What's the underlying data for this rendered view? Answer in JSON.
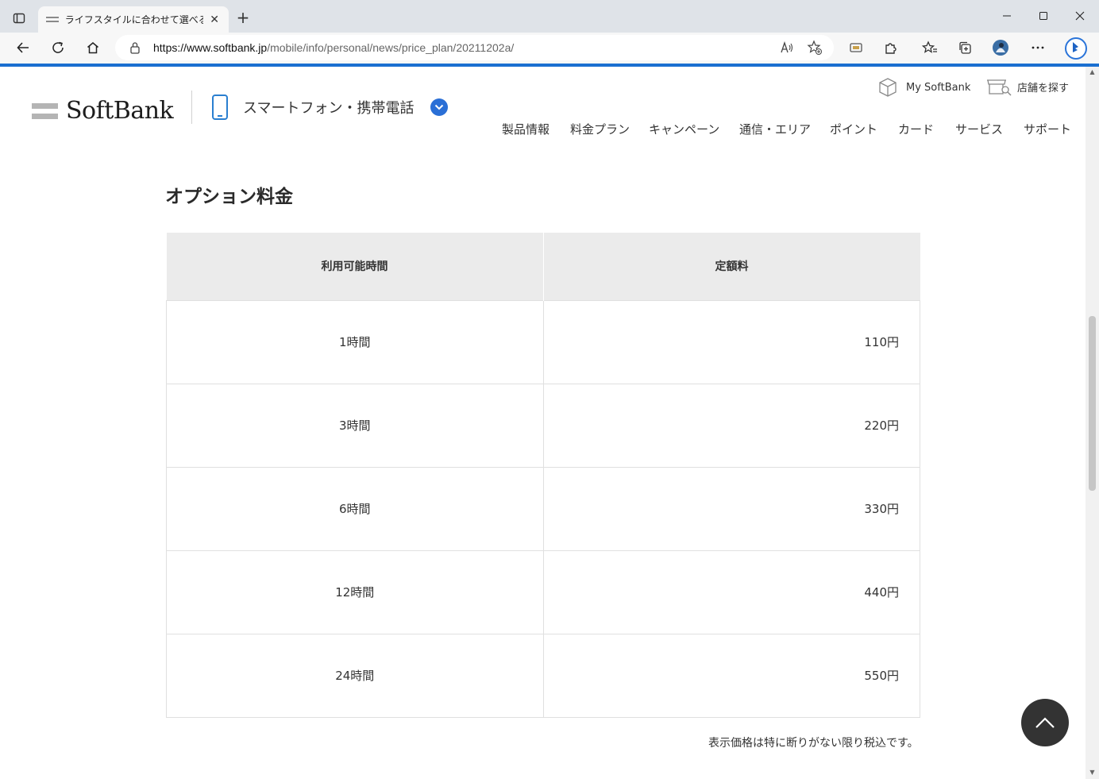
{
  "browser": {
    "tab_title": "ライフスタイルに合わせて選べる「時間",
    "url_host": "https://www.softbank.jp",
    "url_path": "/mobile/info/personal/news/price_plan/20211202a/",
    "accent_color": "#1a6fd0"
  },
  "header": {
    "logo_text": "SoftBank",
    "category_label": "スマートフォン・携帯電話",
    "utility_links": [
      {
        "label": "My SoftBank",
        "icon": "cube-icon"
      },
      {
        "label": "店舗を探す",
        "icon": "store-search-icon"
      }
    ],
    "nav": [
      "製品情報",
      "料金プラン",
      "キャンペーン",
      "通信・エリア",
      "ポイント",
      "カード",
      "サービス",
      "サポート"
    ]
  },
  "content": {
    "section_title": "オプション料金",
    "table": {
      "headers": [
        "利用可能時間",
        "定額料"
      ],
      "rows": [
        {
          "time": "1時間",
          "fee": "110円"
        },
        {
          "time": "3時間",
          "fee": "220円"
        },
        {
          "time": "6時間",
          "fee": "330円"
        },
        {
          "time": "12時間",
          "fee": "440円"
        },
        {
          "time": "24時間",
          "fee": "550円"
        }
      ]
    },
    "tax_note": "表示価格は特に断りがない限り税込です。"
  }
}
